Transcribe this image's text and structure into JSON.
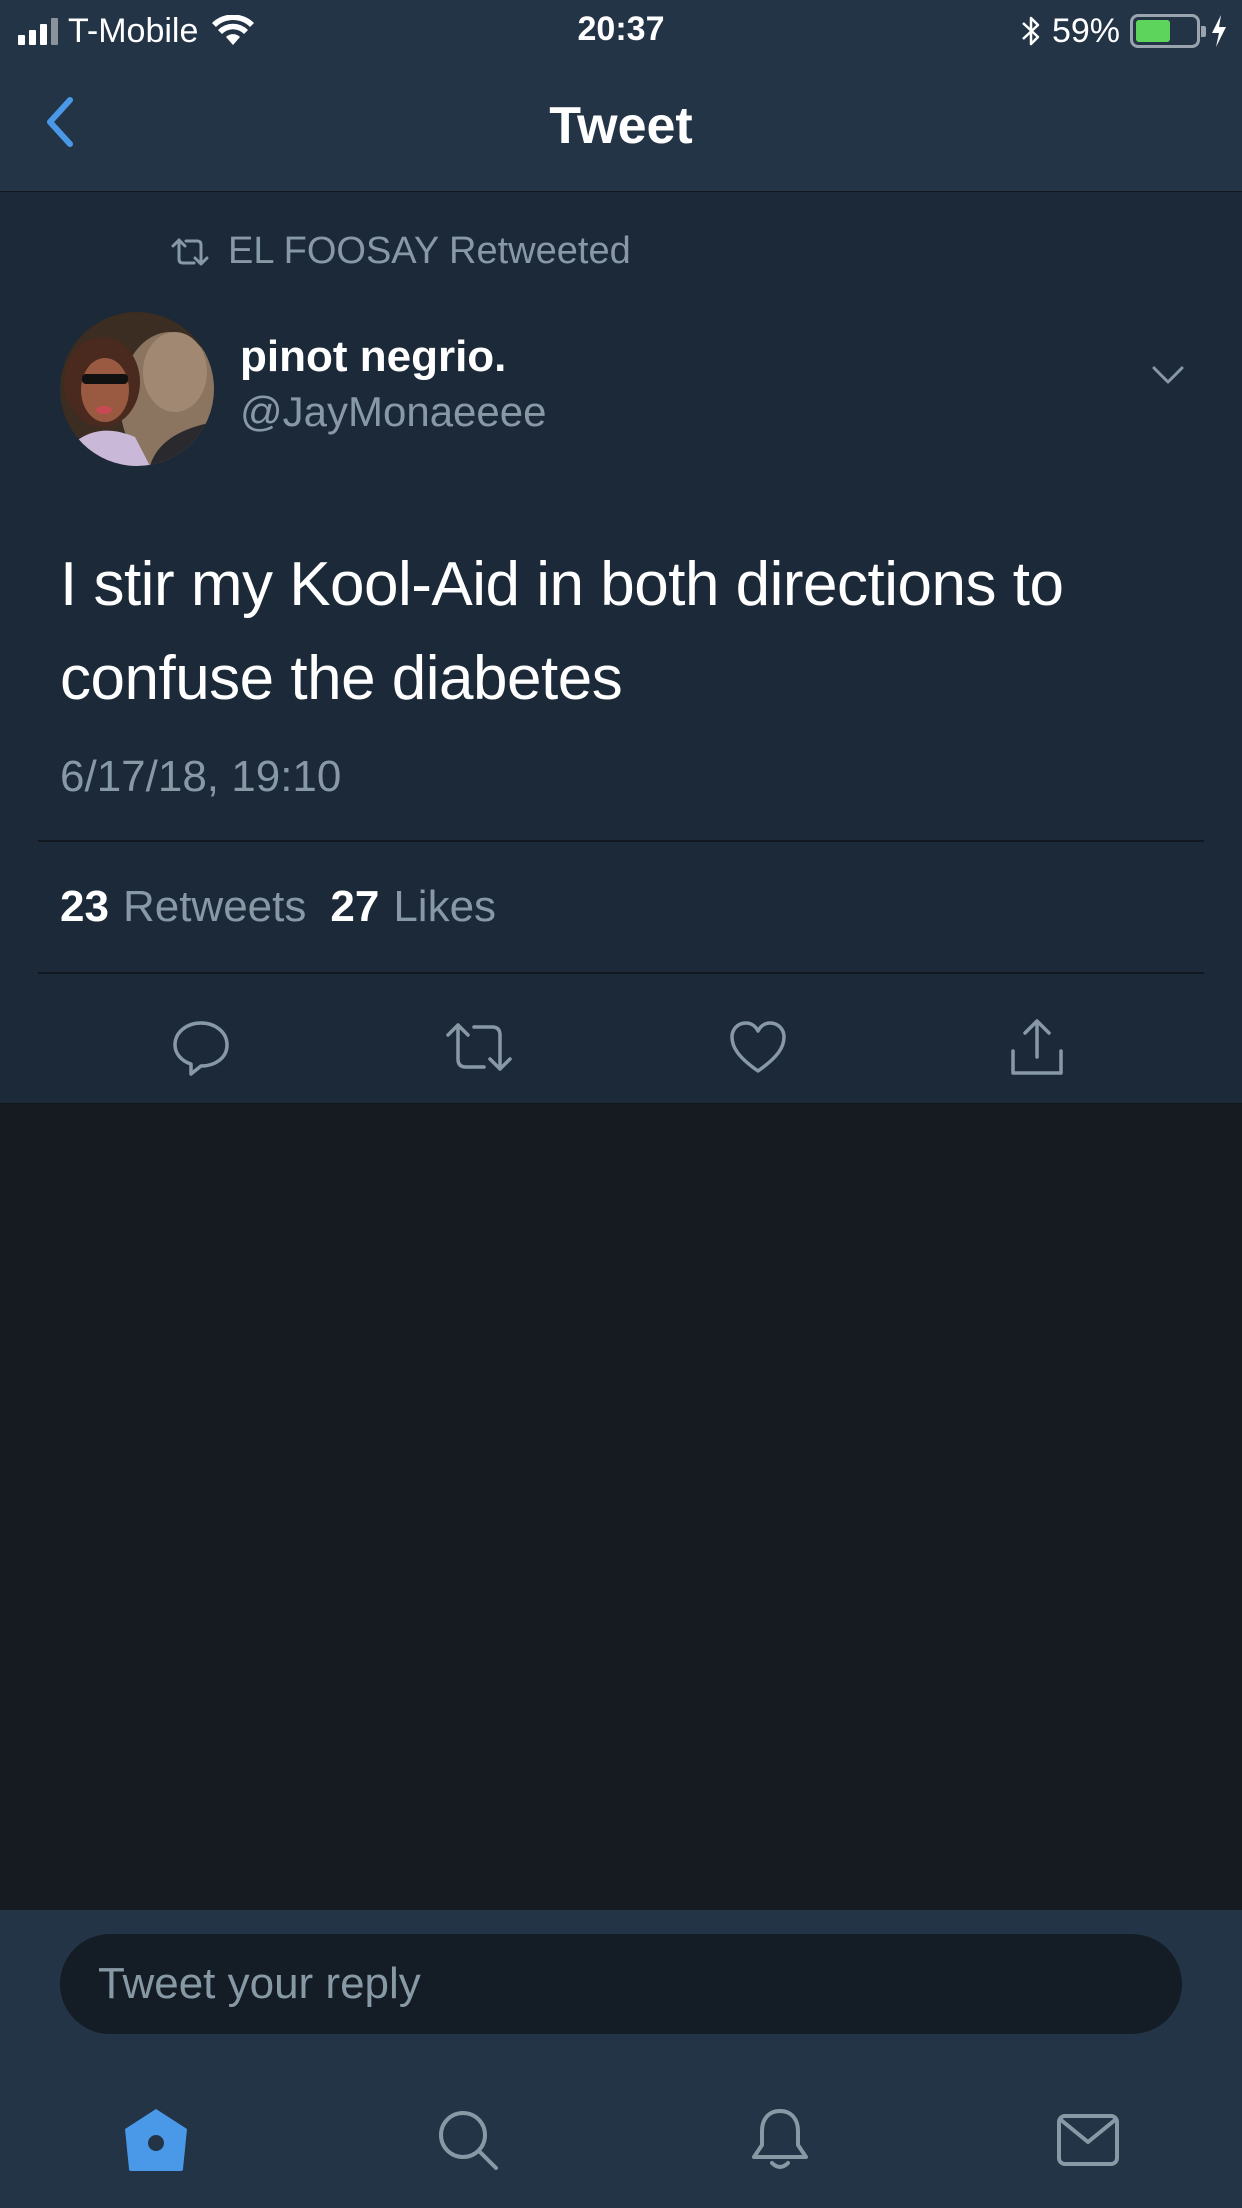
{
  "status_bar": {
    "carrier": "T-Mobile",
    "time": "20:37",
    "battery_percent": "59%",
    "battery_level": 0.59
  },
  "nav": {
    "title": "Tweet",
    "back_icon": "chevron-left-icon"
  },
  "tweet": {
    "retweet_context": "EL FOOSAY Retweeted",
    "author_name": "pinot negrio.",
    "author_handle": "@JayMonaeeee",
    "text": "I stir my Kool-Aid in both directions to confuse the diabetes",
    "timestamp": "6/17/18, 19:10",
    "retweet_count": "23",
    "retweets_label": "Retweets",
    "like_count": "27",
    "likes_label": "Likes",
    "actions": [
      "reply-icon",
      "retweet-icon",
      "like-icon",
      "share-icon"
    ]
  },
  "reply": {
    "placeholder": "Tweet your reply"
  },
  "tab_bar": {
    "tabs": [
      "home-icon",
      "search-icon",
      "notifications-icon",
      "messages-icon"
    ],
    "active": "home-icon"
  },
  "colors": {
    "accent": "#4a99e9",
    "background": "#161b22",
    "card": "#1c2938",
    "bar": "#243447",
    "secondary_text": "#8899a6"
  }
}
